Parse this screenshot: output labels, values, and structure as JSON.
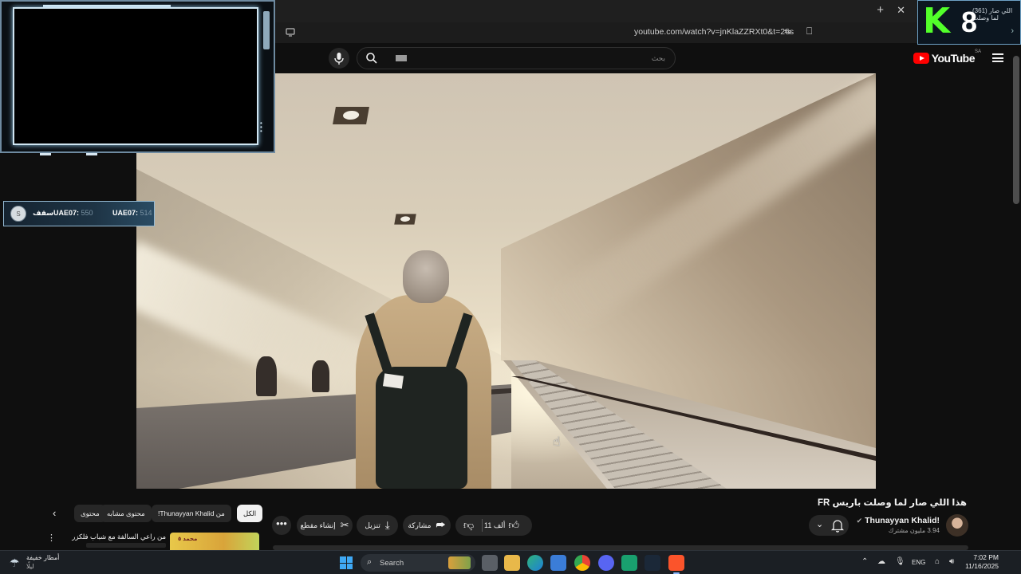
{
  "browser": {
    "tab_title": "(361) اللي صار لما وصلت",
    "url": "youtube.com/watch?v=jnKlaZZRXt0&t=26s"
  },
  "youtube_header": {
    "search_placeholder": "بحث",
    "logo_text": "YouTube",
    "country_code": "SA"
  },
  "overlay": {
    "score_left_label": "سقف",
    "score1_label": "UAE07:",
    "score1_value": "550",
    "score2_label": "UAE07:",
    "score2_value": "514",
    "badge_k": "K",
    "badge_8": "8",
    "ball_label": "S"
  },
  "video_info": {
    "title": "هذا اللي صار لما وصلت باريس FR",
    "channel_name": "Thunayyan Khalid!",
    "subscribers": "3.94 مليون مشترك",
    "likes": "11 ألف",
    "share_label": "مشاركة",
    "download_label": "تنزيل",
    "clip_label": "إنشاء مقطع",
    "more_label": "•••"
  },
  "chips": {
    "all": "الكل",
    "from_channel": "من Thunayyan Khalid!",
    "related": "محتوى مشابه",
    "more": "محتوى"
  },
  "recommendation": {
    "title": "من راعي السالفة مع شباب فلكزر",
    "thumb_text": "محمد ٥"
  },
  "taskbar": {
    "weather_line1": "أمطار خفيفة",
    "weather_line2": "ليلًا",
    "search_label": "Search",
    "lang": "ENG",
    "time": "7:02 PM",
    "date": "11/16/2025"
  },
  "icons": {
    "mic": "microphone-icon",
    "search": "search-icon",
    "bell": "bell-icon",
    "like": "thumbs-up-icon",
    "dislike": "thumbs-down-icon",
    "share": "share-icon",
    "download": "download-icon",
    "clip": "scissors-icon",
    "windows": "windows-start-icon"
  },
  "colors": {
    "yt_red": "#ff0000",
    "badge_green": "#52ff2a",
    "overlay_frame": "#cfe5f2",
    "page_bg": "#0f0f0f",
    "taskbar_bg": "#1b1f24"
  }
}
